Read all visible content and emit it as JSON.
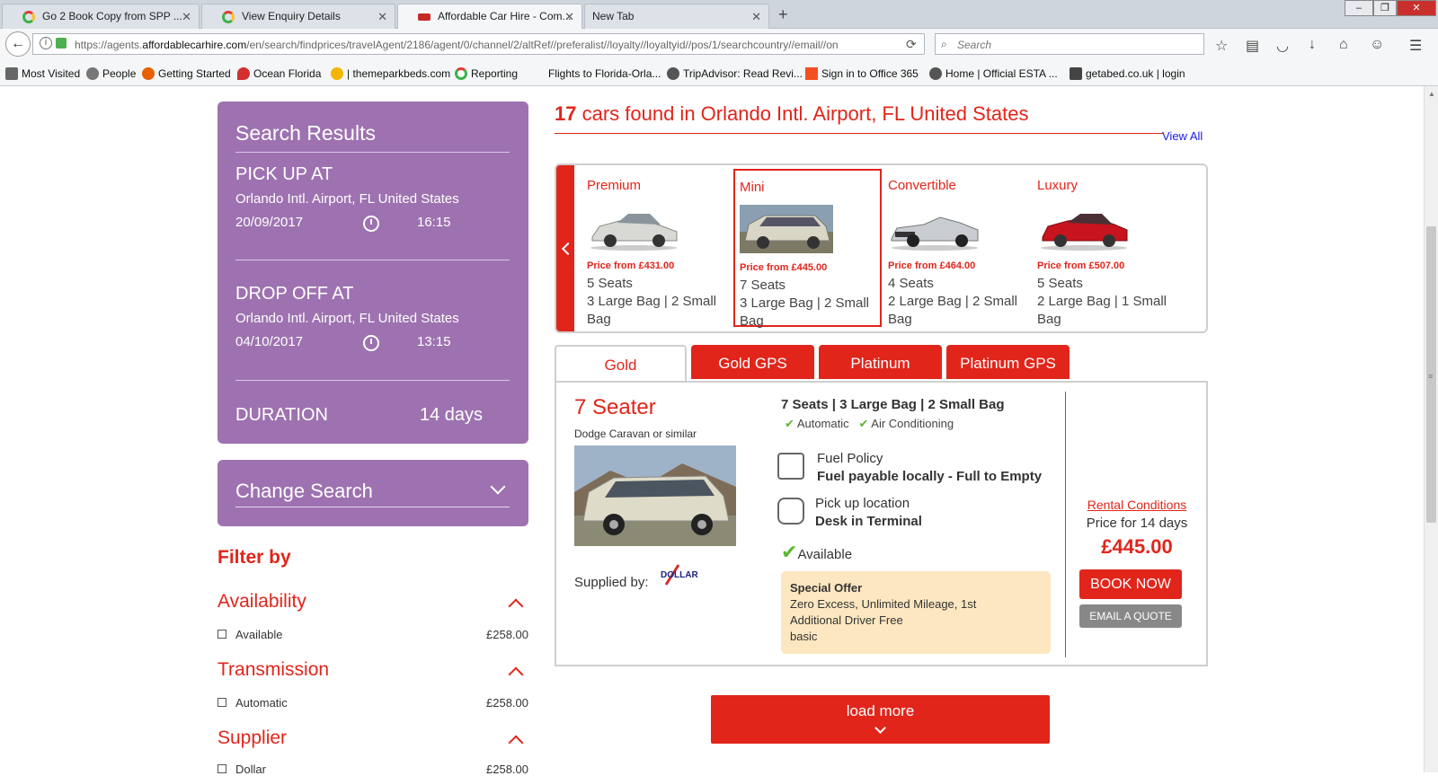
{
  "browser": {
    "tabs": [
      {
        "title": "Go 2 Book Copy from SPP ..."
      },
      {
        "title": "View Enquiry Details"
      },
      {
        "title": "Affordable Car Hire - Com..."
      },
      {
        "title": "New Tab"
      }
    ],
    "url_prefix": "https://agents.",
    "url_host": "affordablecarhire.com",
    "url_path": "/en/search/findprices/travelAgent/2186/agent/0/channel/2/altRef//preferalist//loyalty//loyaltyid//pos/1/searchcountry//email//on",
    "search_placeholder": "Search",
    "bookmarks": [
      "Most Visited",
      "People",
      "Getting Started",
      "Ocean Florida",
      "| themeparkbeds.com",
      "Reporting",
      "Flights to Florida-Orla...",
      "TripAdvisor: Read Revi...",
      "Sign in to Office 365",
      "Home | Official ESTA ...",
      "getabed.co.uk | login"
    ]
  },
  "sidebar": {
    "search_results_title": "Search Results",
    "pickup_label": "PICK UP AT",
    "pickup_location": "Orlando Intl. Airport, FL United States",
    "pickup_date": "20/09/2017",
    "pickup_time": "16:15",
    "dropoff_label": "DROP OFF AT",
    "dropoff_location": "Orlando Intl. Airport, FL United States",
    "dropoff_date": "04/10/2017",
    "dropoff_time": "13:15",
    "duration_label": "DURATION",
    "duration_value": "14 days",
    "change_search": "Change Search"
  },
  "filters": {
    "title": "Filter by",
    "groups": [
      {
        "name": "Availability",
        "item": "Available",
        "price": "£258.00"
      },
      {
        "name": "Transmission",
        "item": "Automatic",
        "price": "£258.00"
      },
      {
        "name": "Supplier",
        "item": "Dollar",
        "price": "£258.00"
      }
    ]
  },
  "results": {
    "count": "17",
    "heading": " cars found in Orlando Intl. Airport, FL United States",
    "view_all": "View All",
    "categories": [
      {
        "name": "Premium",
        "price": "Price from £431.00",
        "seats": "5 Seats",
        "bags": "3 Large Bag | 2 Small Bag",
        "color": "#d8d8d4"
      },
      {
        "name": "Mini",
        "price": "Price from £445.00",
        "seats": "7 Seats",
        "bags": "3 Large Bag | 2 Small Bag",
        "color": "#d9d6c6"
      },
      {
        "name": "Convertible",
        "price": "Price from £464.00",
        "seats": "4 Seats",
        "bags": "2 Large Bag | 2 Small Bag",
        "color": "#c9ccd0"
      },
      {
        "name": "Luxury",
        "price": "Price from £507.00",
        "seats": "5 Seats",
        "bags": "2 Large Bag | 1 Small Bag",
        "color": "#c8141e"
      }
    ]
  },
  "offer_tabs": [
    "Gold",
    "Gold GPS",
    "Platinum",
    "Platinum GPS"
  ],
  "offer": {
    "title": "7 Seater",
    "model": "Dodge Caravan or similar",
    "supplied_by": "Supplied by:",
    "supplier_logo_text": "DOLLAR",
    "specs": "7 Seats | 3 Large Bag | 2 Small Bag",
    "feature1": "Automatic",
    "feature2": "Air Conditioning",
    "fuel_label": "Fuel Policy",
    "fuel_value": "Fuel payable locally - Full to Empty",
    "pickup_label": "Pick up location",
    "pickup_value": "Desk in Terminal",
    "available": "Available",
    "special_title": "Special Offer",
    "special_line1": "Zero Excess, Unlimited Mileage, 1st",
    "special_line2": "Additional Driver Free",
    "special_line3": "basic",
    "rental_conditions": "Rental Conditions",
    "price_for": "Price for 14 days",
    "amount": "£445.00",
    "book_now": "BOOK NOW",
    "email_quote": "EMAIL A QUOTE"
  },
  "load_more": "load more"
}
